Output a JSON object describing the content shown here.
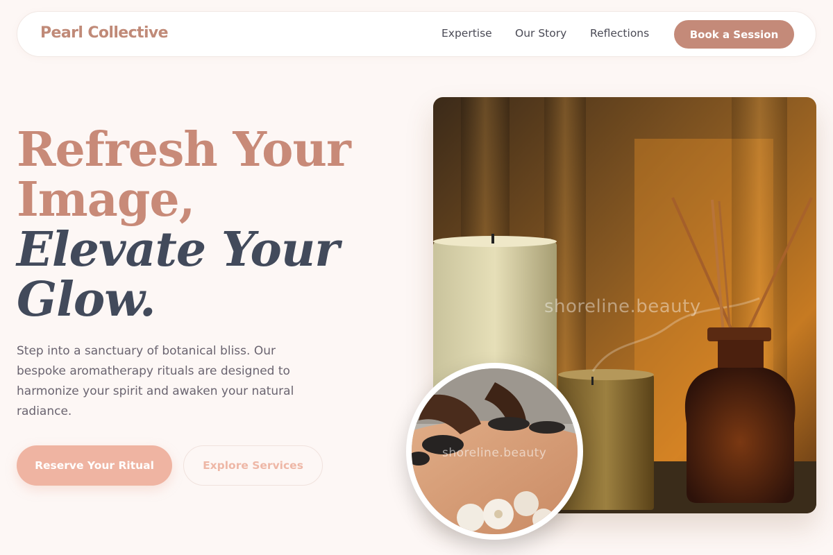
{
  "nav": {
    "logo": "Pearl Collective",
    "links": [
      "Expertise",
      "Our Story",
      "Reflections"
    ],
    "cta": "Book a Session"
  },
  "hero": {
    "headline_line1": "Refresh Your Image,",
    "headline_line2": "Elevate Your Glow.",
    "description": "Step into a sanctuary of botanical bliss. Our bespoke aromatherapy rituals are designed to harmonize your spirit and awaken your natural radiance.",
    "primary_button": "Reserve Your Ritual",
    "secondary_button": "Explore Services"
  },
  "images": {
    "main_watermark": "shoreline.beauty",
    "circle_watermark": "shoreline.beauty"
  },
  "colors": {
    "background": "#fdf7f5",
    "accent": "#c48a79",
    "heading_dark": "#424a5b",
    "primary_button": "#efb4a2"
  }
}
